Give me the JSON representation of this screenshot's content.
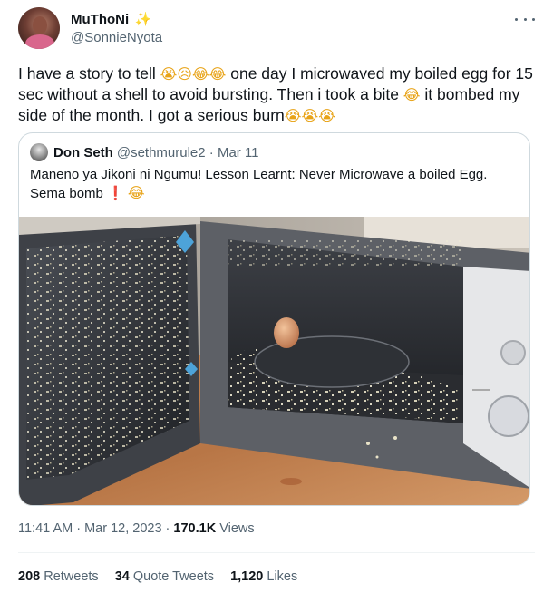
{
  "author": {
    "display_name": "MuThoNi",
    "handle": "@SonnieNyota"
  },
  "icons": {
    "sparkle": "sparkles-icon",
    "more": "more-horizontal-icon"
  },
  "tweet": {
    "text_part1": "I have a story to tell ",
    "emoji_group1": "😭😥😂😂",
    "text_part2": "  one day I microwaved my boiled egg for 15 sec without a shell to avoid bursting. Then i took a bite ",
    "emoji_group2": "😂",
    "text_part3": " it bombed my side of the month. I got a serious burn",
    "emoji_group3": "😭😭😭"
  },
  "quote": {
    "author_name": "Don Seth",
    "author_handle": "@sethmurule2 · Mar 11",
    "text_line1": "Maneno ya Jikoni ni Ngumu! Lesson Learnt: Never Microwave a boiled Egg.",
    "text_line2_pre": "Sema bomb ",
    "exclamation": "❗",
    "laugh": "😂",
    "image_subject": "microwave-with-exploded-egg"
  },
  "meta": {
    "time": "11:41 AM · Mar 12, 2023 · ",
    "views_count": "170.1K",
    "views_label": " Views"
  },
  "stats": {
    "retweets_count": "208",
    "retweets_label": " Retweets",
    "quotes_count": "34",
    "quotes_label": " Quote Tweets",
    "likes_count": "1,120",
    "likes_label": " Likes"
  },
  "colors": {
    "text_primary": "#0f1419",
    "text_secondary": "#536471",
    "border": "#cfd9de",
    "accent_emoji": "#e8a317"
  }
}
